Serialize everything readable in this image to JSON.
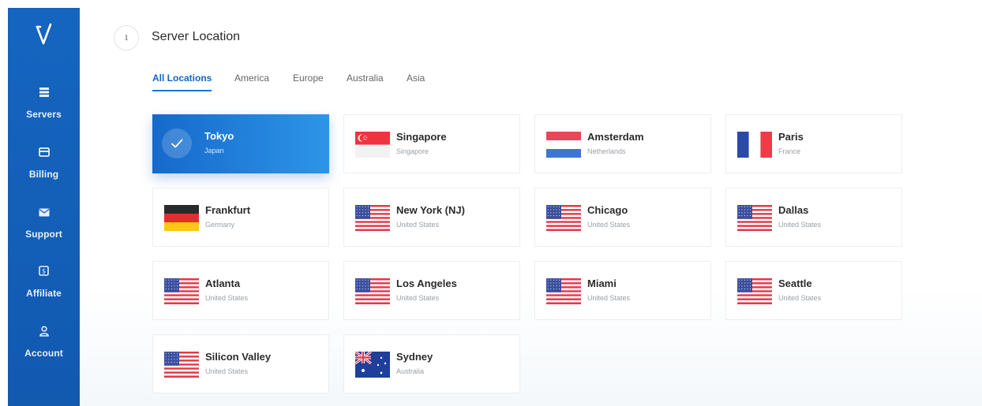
{
  "sidebar": {
    "items": [
      {
        "label": "Servers",
        "icon": "server-icon"
      },
      {
        "label": "Billing",
        "icon": "card-icon"
      },
      {
        "label": "Support",
        "icon": "mail-icon"
      },
      {
        "label": "Affiliate",
        "icon": "dollar-icon"
      },
      {
        "label": "Account",
        "icon": "user-icon"
      }
    ]
  },
  "step": {
    "number": "1",
    "title": "Server Location"
  },
  "tabs": [
    {
      "label": "All Locations",
      "active": true
    },
    {
      "label": "America"
    },
    {
      "label": "Europe"
    },
    {
      "label": "Australia"
    },
    {
      "label": "Asia"
    }
  ],
  "locations": [
    {
      "city": "Tokyo",
      "country": "Japan",
      "selected": true
    },
    {
      "city": "Singapore",
      "country": "Singapore",
      "flag": "singapore-flag-icon"
    },
    {
      "city": "Amsterdam",
      "country": "Netherlands",
      "flag": "netherlands-flag-icon"
    },
    {
      "city": "Paris",
      "country": "France",
      "flag": "france-flag-icon"
    },
    {
      "city": "Frankfurt",
      "country": "Germany",
      "flag": "germany-flag-icon"
    },
    {
      "city": "New York (NJ)",
      "country": "United States",
      "flag": "us-flag-icon"
    },
    {
      "city": "Chicago",
      "country": "United States",
      "flag": "us-flag-icon"
    },
    {
      "city": "Dallas",
      "country": "United States",
      "flag": "us-flag-icon"
    },
    {
      "city": "Atlanta",
      "country": "United States",
      "flag": "us-flag-icon"
    },
    {
      "city": "Los Angeles",
      "country": "United States",
      "flag": "us-flag-icon"
    },
    {
      "city": "Miami",
      "country": "United States",
      "flag": "us-flag-icon"
    },
    {
      "city": "Seattle",
      "country": "United States",
      "flag": "us-flag-icon"
    },
    {
      "city": "Silicon Valley",
      "country": "United States",
      "flag": "us-flag-icon"
    },
    {
      "city": "Sydney",
      "country": "Australia",
      "flag": "australia-flag-icon"
    }
  ],
  "colors": {
    "accent": "#1565c0",
    "sidebar": "#1565c0",
    "selected_start": "#1669cb",
    "selected_end": "#2d95e8"
  }
}
